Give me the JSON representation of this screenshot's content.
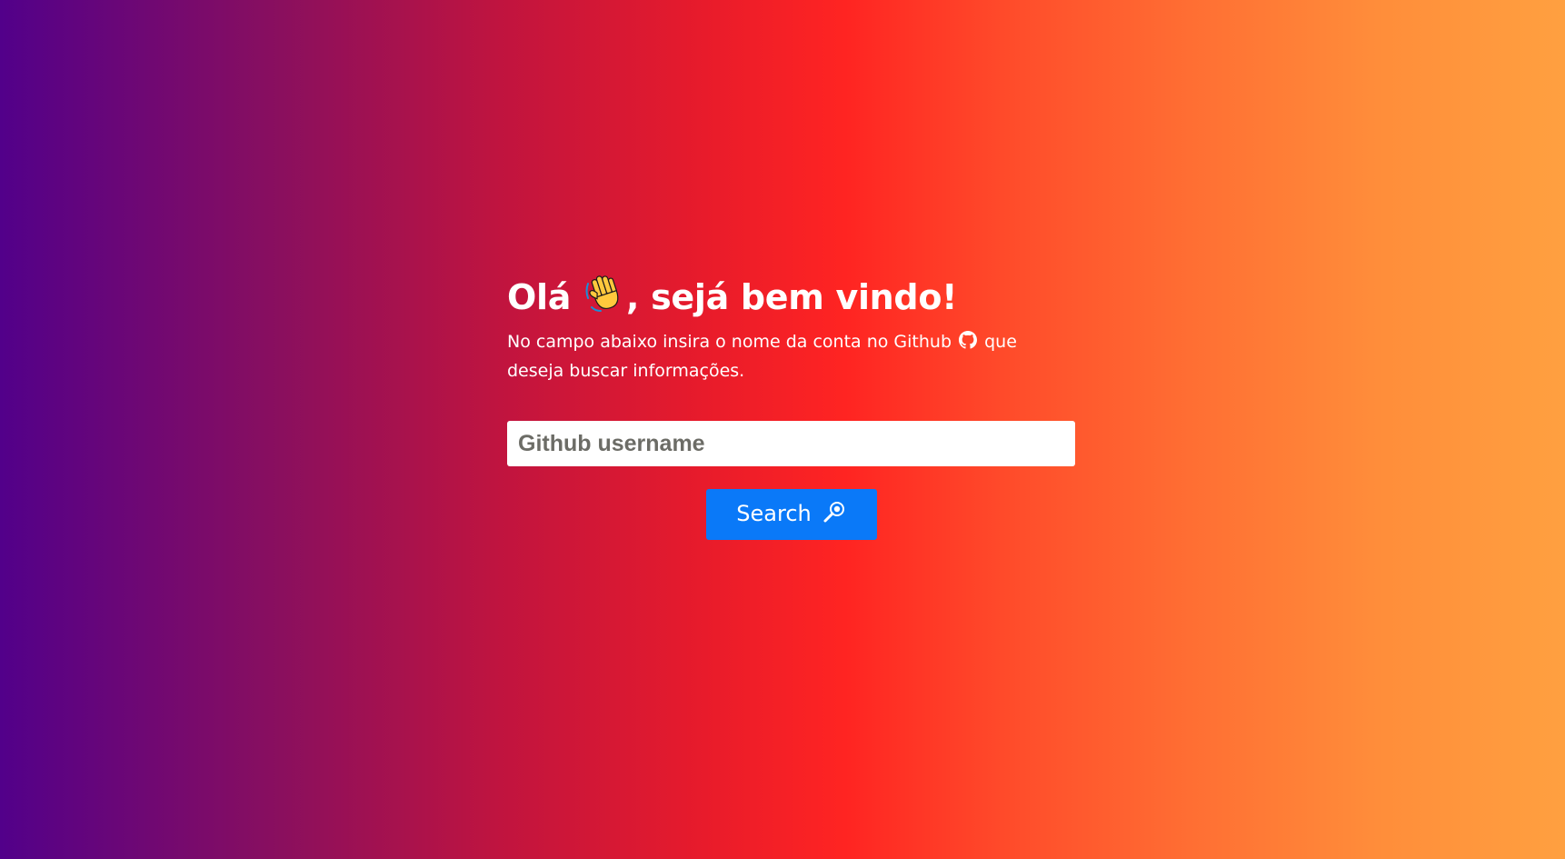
{
  "header": {
    "title_prefix": "Olá",
    "title_suffix": ", sejá bem vindo!",
    "title_icon": "waving-hand-icon"
  },
  "intro": {
    "text_before_icon": "No campo abaixo insira o nome da conta no Github",
    "text_after_icon": "que deseja buscar informações.",
    "inline_icon": "github-icon"
  },
  "search": {
    "placeholder": "Github username",
    "value": "",
    "button_label": "Search",
    "button_icon": "magnifier-icon",
    "button_color": "#0a79f8"
  },
  "theme": {
    "gradient_start": "#52008a",
    "gradient_mid": "#ff2422",
    "gradient_end": "#ffa040"
  }
}
